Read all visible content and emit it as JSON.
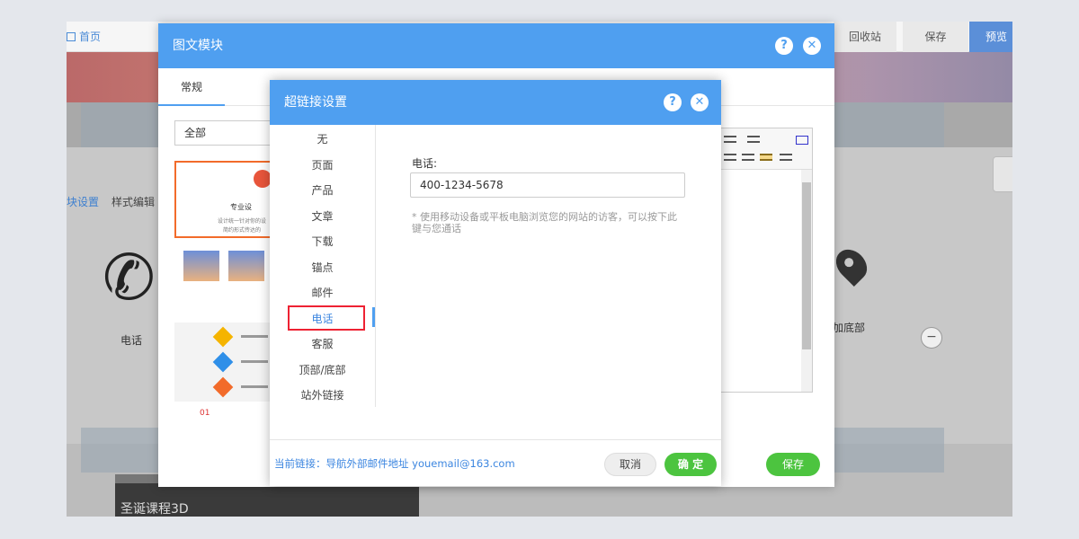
{
  "background": {
    "topbar": {
      "home": "首页",
      "recycle": "回收站",
      "save": "保存",
      "preview": "预览"
    },
    "side_tabs": [
      "块设置",
      "样式编辑"
    ],
    "phone_label": "电话",
    "pin_label": "返加底部",
    "video_caption": "圣诞课程3D"
  },
  "module_dialog": {
    "title": "图文模块",
    "help": "?",
    "close": "✕",
    "tab": "常规",
    "filter": "全部",
    "thumb1_title": "专业设",
    "thumb1_sub": "设计统一针对你的设",
    "thumb1_sub2": "简约形式传达的",
    "thumb4_num": "01",
    "save": "保存"
  },
  "link_dialog": {
    "title": "超链接设置",
    "help": "?",
    "close": "✕",
    "nav": [
      "无",
      "页面",
      "产品",
      "文章",
      "下载",
      "锚点",
      "邮件",
      "电话",
      "客服",
      "顶部/底部",
      "站外链接"
    ],
    "selected_nav": "电话",
    "field_label": "电话:",
    "field_value": "400-1234-5678",
    "hint": "* 使用移动设备或平板电脑浏览您的网站的访客，可以按下此键与您通话",
    "current_link": "当前链接：导航外部邮件地址 youemail@163.com",
    "cancel": "取消",
    "ok": "确 定"
  },
  "colors": {
    "primary": "#4f9ff0",
    "success": "#4cc43f",
    "highlight": "#e22233"
  }
}
